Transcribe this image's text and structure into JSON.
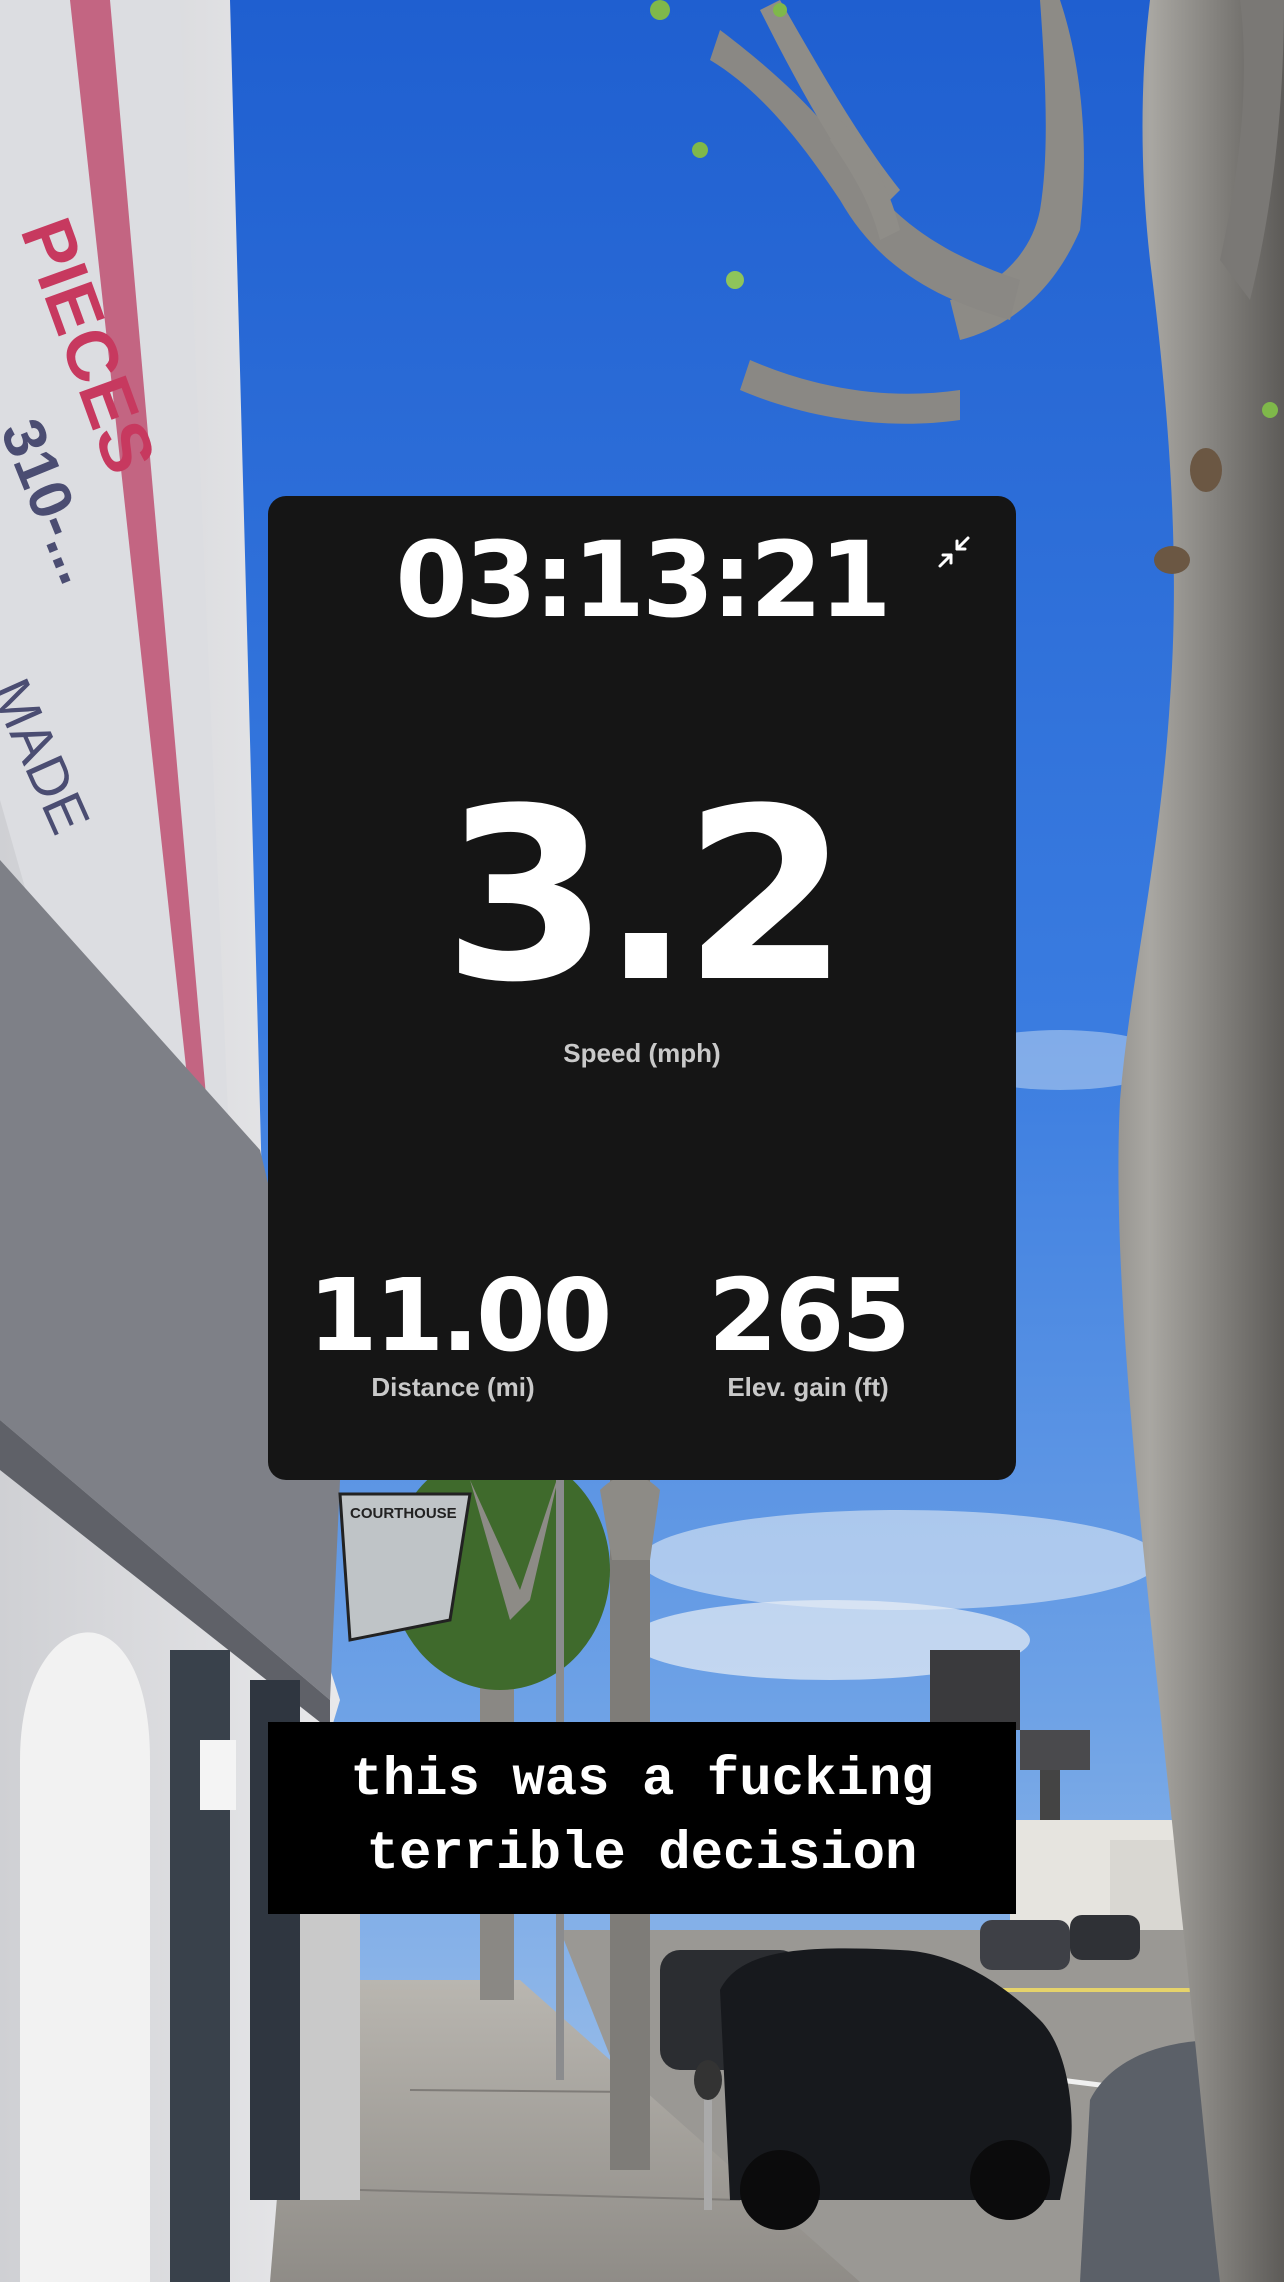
{
  "background": {
    "description_icon": "street-photo",
    "sign_text": "COURTHOUSE"
  },
  "tracker": {
    "elapsed_time": "03:13:21",
    "collapse_icon": "collapse-arrows-icon",
    "speed": {
      "value": "3.2",
      "label": "Speed (mph)"
    },
    "distance": {
      "value": "11.00",
      "label": "Distance (mi)"
    },
    "elevation_gain": {
      "value": "265",
      "label": "Elev. gain (ft)"
    }
  },
  "caption": {
    "text": "this was a fucking\nterrible decision"
  },
  "colors": {
    "card_background": "#151515",
    "caption_background": "#000000",
    "text_primary": "#ffffff",
    "text_secondary": "#c9c9c9",
    "sky": "#2f6fd6"
  }
}
